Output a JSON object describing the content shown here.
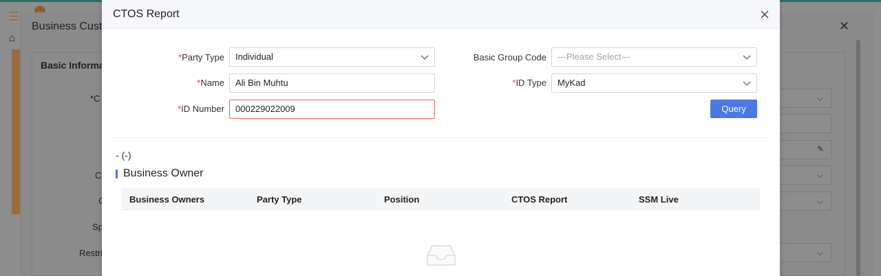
{
  "background": {
    "panel_title": "Business Custo",
    "card_title": "Basic Informat",
    "labels": [
      "*C",
      "C",
      "C",
      "Sp",
      "Restri"
    ]
  },
  "modal": {
    "title": "CTOS Report",
    "form": {
      "party_type": {
        "label": "Party Type",
        "value": "Individual"
      },
      "name": {
        "label": "Name",
        "value": "Ali Bin Muhtu"
      },
      "id_number": {
        "label": "ID Number",
        "value": "000229022009"
      },
      "basic_group_code": {
        "label": "Basic Group Code",
        "placeholder": "---Please Select---"
      },
      "id_type": {
        "label": "ID Type",
        "value": "MyKad"
      },
      "required_mark": "*",
      "query_label": "Query"
    },
    "summary": "- (-)",
    "section_title": "Business Owner",
    "table": {
      "columns": [
        "Business Owners",
        "Party Type",
        "Position",
        "CTOS Report",
        "SSM Live"
      ]
    }
  },
  "colors": {
    "accent": "#4b78e3",
    "required": "#e03a3a",
    "error_border": "#f06565"
  },
  "icons": {
    "close": "close-icon",
    "chevron": "chevron-down-icon",
    "empty": "empty-inbox-icon"
  }
}
